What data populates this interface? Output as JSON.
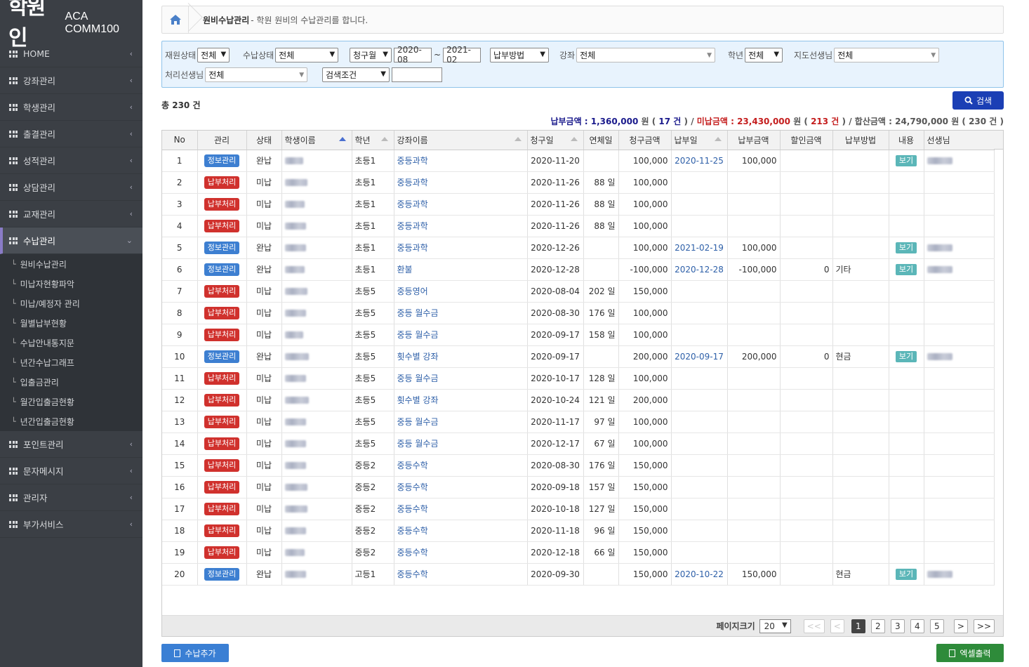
{
  "logo": {
    "main": "학원인",
    "sub": "ACA COMM100"
  },
  "sidebar": {
    "items": [
      {
        "label": "HOME"
      },
      {
        "label": "강좌관리"
      },
      {
        "label": "학생관리"
      },
      {
        "label": "출결관리"
      },
      {
        "label": "성적관리"
      },
      {
        "label": "상담관리"
      },
      {
        "label": "교재관리"
      },
      {
        "label": "수납관리"
      },
      {
        "label": "포인트관리"
      },
      {
        "label": "문자메시지"
      },
      {
        "label": "관리자"
      },
      {
        "label": "부가서비스"
      }
    ],
    "submenu": [
      "원비수납관리",
      "미납자현황파악",
      "미납/예정자 관리",
      "월별납부현황",
      "수납안내통지문",
      "년간수납그래프",
      "입출금관리",
      "월간입출금현황",
      "년간입출금현황"
    ]
  },
  "breadcrumb": {
    "title": "원비수납관리",
    "desc": "- 학원 원비의 수납관리를 합니다."
  },
  "filters": {
    "enroll_label": "재원상태",
    "enroll_value": "전체",
    "pay_status_label": "수납상태",
    "pay_status_value": "전체",
    "month_type": "청구월",
    "from": "2020-08",
    "tilde": "~",
    "to": "2021-02",
    "pay_method": "납부방법",
    "course_label": "강좌",
    "course_value": "전체",
    "grade_label": "학년",
    "grade_value": "전체",
    "teacher_label": "지도선생님",
    "teacher_value": "전체",
    "handler_label": "처리선생님",
    "handler_value": "전체",
    "search_cond": "검색조건",
    "search_text": ""
  },
  "search_button": "검색",
  "total": "총 230 건",
  "summary": {
    "paid_label": "납부금액 : 1,360,000",
    "paid_unit": "원 (",
    "paid_count": "17 건",
    "paid_close": ") /",
    "unpaid_label": "미납금액 : 23,430,000",
    "unpaid_unit": "원 (",
    "unpaid_count": "213 건",
    "unpaid_close": ") /",
    "sum_label": "합산금액 : 24,790,000 원 ( 230 건 )"
  },
  "table": {
    "headers": [
      "No",
      "관리",
      "상태",
      "학생이름",
      "학년",
      "강좌이름",
      "청구일",
      "연체일",
      "청구금액",
      "납부일",
      "납부금액",
      "할인금액",
      "납부방법",
      "내용",
      "선생님"
    ],
    "rows": [
      {
        "no": "1",
        "action": "정보관리",
        "status": "완납",
        "grade": "초등1",
        "course": "중등과학",
        "billed": "2020-11-20",
        "overdue": "",
        "amount": "100,000",
        "paid_date": "2020-11-25",
        "paid_amount": "100,000",
        "discount": "",
        "method": "",
        "view": "보기"
      },
      {
        "no": "2",
        "action": "납부처리",
        "status": "미납",
        "grade": "초등1",
        "course": "중등과학",
        "billed": "2020-11-26",
        "overdue": "88 일",
        "amount": "100,000",
        "paid_date": "",
        "paid_amount": "",
        "discount": "",
        "method": "",
        "view": ""
      },
      {
        "no": "3",
        "action": "납부처리",
        "status": "미납",
        "grade": "초등1",
        "course": "중등과학",
        "billed": "2020-11-26",
        "overdue": "88 일",
        "amount": "100,000",
        "paid_date": "",
        "paid_amount": "",
        "discount": "",
        "method": "",
        "view": ""
      },
      {
        "no": "4",
        "action": "납부처리",
        "status": "미납",
        "grade": "초등1",
        "course": "중등과학",
        "billed": "2020-11-26",
        "overdue": "88 일",
        "amount": "100,000",
        "paid_date": "",
        "paid_amount": "",
        "discount": "",
        "method": "",
        "view": ""
      },
      {
        "no": "5",
        "action": "정보관리",
        "status": "완납",
        "grade": "초등1",
        "course": "중등과학",
        "billed": "2020-12-26",
        "overdue": "",
        "amount": "100,000",
        "paid_date": "2021-02-19",
        "paid_amount": "100,000",
        "discount": "",
        "method": "",
        "view": "보기"
      },
      {
        "no": "6",
        "action": "정보관리",
        "status": "완납",
        "grade": "초등1",
        "course": "환불",
        "billed": "2020-12-28",
        "overdue": "",
        "amount": "-100,000",
        "paid_date": "2020-12-28",
        "paid_amount": "-100,000",
        "discount": "0",
        "method": "기타",
        "view": "보기"
      },
      {
        "no": "7",
        "action": "납부처리",
        "status": "미납",
        "grade": "초등5",
        "course": "중등영어",
        "billed": "2020-08-04",
        "overdue": "202 일",
        "amount": "150,000",
        "paid_date": "",
        "paid_amount": "",
        "discount": "",
        "method": "",
        "view": ""
      },
      {
        "no": "8",
        "action": "납부처리",
        "status": "미납",
        "grade": "초등5",
        "course": "중등 월수금",
        "billed": "2020-08-30",
        "overdue": "176 일",
        "amount": "100,000",
        "paid_date": "",
        "paid_amount": "",
        "discount": "",
        "method": "",
        "view": ""
      },
      {
        "no": "9",
        "action": "납부처리",
        "status": "미납",
        "grade": "초등5",
        "course": "중등 월수금",
        "billed": "2020-09-17",
        "overdue": "158 일",
        "amount": "100,000",
        "paid_date": "",
        "paid_amount": "",
        "discount": "",
        "method": "",
        "view": ""
      },
      {
        "no": "10",
        "action": "정보관리",
        "status": "완납",
        "grade": "초등5",
        "course": "횟수별 강좌",
        "billed": "2020-09-17",
        "overdue": "",
        "amount": "200,000",
        "paid_date": "2020-09-17",
        "paid_amount": "200,000",
        "discount": "0",
        "method": "현금",
        "view": "보기"
      },
      {
        "no": "11",
        "action": "납부처리",
        "status": "미납",
        "grade": "초등5",
        "course": "중등 월수금",
        "billed": "2020-10-17",
        "overdue": "128 일",
        "amount": "100,000",
        "paid_date": "",
        "paid_amount": "",
        "discount": "",
        "method": "",
        "view": ""
      },
      {
        "no": "12",
        "action": "납부처리",
        "status": "미납",
        "grade": "초등5",
        "course": "횟수별 강좌",
        "billed": "2020-10-24",
        "overdue": "121 일",
        "amount": "200,000",
        "paid_date": "",
        "paid_amount": "",
        "discount": "",
        "method": "",
        "view": ""
      },
      {
        "no": "13",
        "action": "납부처리",
        "status": "미납",
        "grade": "초등5",
        "course": "중등 월수금",
        "billed": "2020-11-17",
        "overdue": "97 일",
        "amount": "100,000",
        "paid_date": "",
        "paid_amount": "",
        "discount": "",
        "method": "",
        "view": ""
      },
      {
        "no": "14",
        "action": "납부처리",
        "status": "미납",
        "grade": "초등5",
        "course": "중등 월수금",
        "billed": "2020-12-17",
        "overdue": "67 일",
        "amount": "100,000",
        "paid_date": "",
        "paid_amount": "",
        "discount": "",
        "method": "",
        "view": ""
      },
      {
        "no": "15",
        "action": "납부처리",
        "status": "미납",
        "grade": "중등2",
        "course": "중등수학",
        "billed": "2020-08-30",
        "overdue": "176 일",
        "amount": "150,000",
        "paid_date": "",
        "paid_amount": "",
        "discount": "",
        "method": "",
        "view": ""
      },
      {
        "no": "16",
        "action": "납부처리",
        "status": "미납",
        "grade": "중등2",
        "course": "중등수학",
        "billed": "2020-09-18",
        "overdue": "157 일",
        "amount": "150,000",
        "paid_date": "",
        "paid_amount": "",
        "discount": "",
        "method": "",
        "view": ""
      },
      {
        "no": "17",
        "action": "납부처리",
        "status": "미납",
        "grade": "중등2",
        "course": "중등수학",
        "billed": "2020-10-18",
        "overdue": "127 일",
        "amount": "150,000",
        "paid_date": "",
        "paid_amount": "",
        "discount": "",
        "method": "",
        "view": ""
      },
      {
        "no": "18",
        "action": "납부처리",
        "status": "미납",
        "grade": "중등2",
        "course": "중등수학",
        "billed": "2020-11-18",
        "overdue": "96 일",
        "amount": "150,000",
        "paid_date": "",
        "paid_amount": "",
        "discount": "",
        "method": "",
        "view": ""
      },
      {
        "no": "19",
        "action": "납부처리",
        "status": "미납",
        "grade": "중등2",
        "course": "중등수학",
        "billed": "2020-12-18",
        "overdue": "66 일",
        "amount": "150,000",
        "paid_date": "",
        "paid_amount": "",
        "discount": "",
        "method": "",
        "view": ""
      },
      {
        "no": "20",
        "action": "정보관리",
        "status": "완납",
        "grade": "고등1",
        "course": "중등수학",
        "billed": "2020-09-30",
        "overdue": "",
        "amount": "150,000",
        "paid_date": "2020-10-22",
        "paid_amount": "150,000",
        "discount": "",
        "method": "현금",
        "view": "보기"
      }
    ]
  },
  "pager": {
    "label": "페이지크기",
    "size": "20",
    "first": "<<",
    "prev": "<",
    "pages": [
      "1",
      "2",
      "3",
      "4",
      "5"
    ],
    "next": ">",
    "last": ">>"
  },
  "buttons": {
    "add": "수납추가",
    "excel": "엑셀출력"
  }
}
